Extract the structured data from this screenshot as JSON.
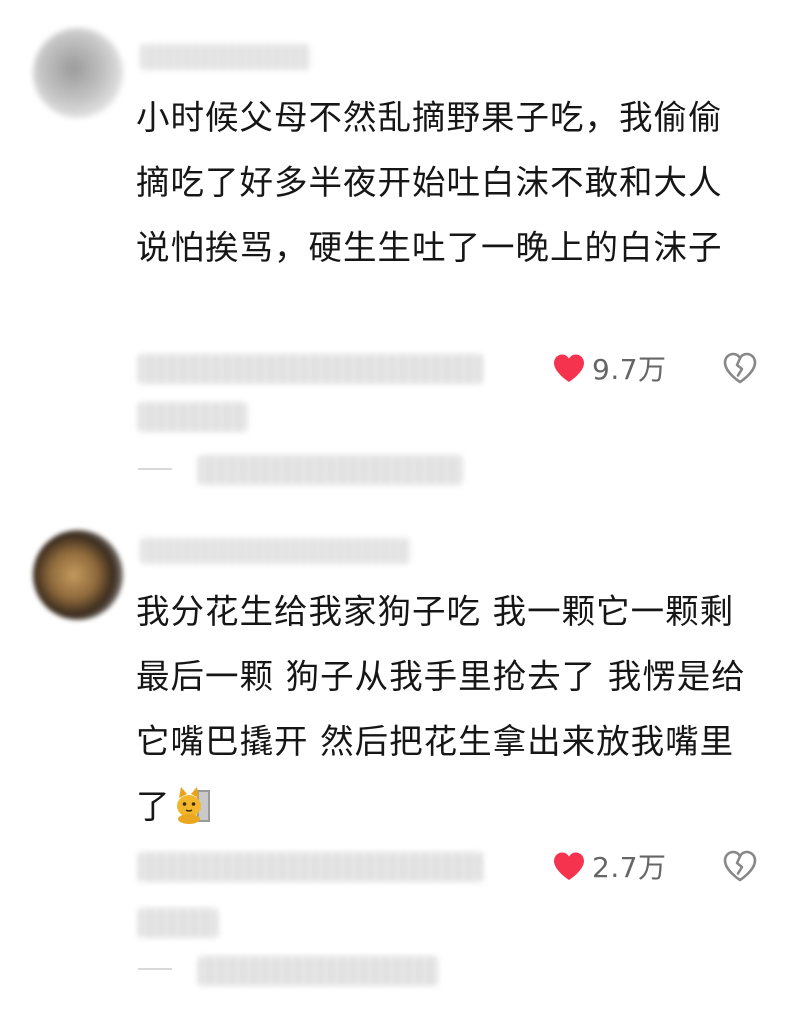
{
  "comments": [
    {
      "text": "小时候父母不然乱摘野果子吃，我偷偷摘吃了好多半夜开始吐白沫不敢和大人说怕挨骂，硬生生吐了一晚上的白沫子",
      "like_count": "9.7万",
      "avatar_icon": "blurred-avatar",
      "like_icon": "heart-icon",
      "dislike_icon": "broken-heart-icon"
    },
    {
      "text": "我分花生给我家狗子吃 我一颗它一颗剩最后一颗 狗子从我手里抢去了 我愣是给它嘴巴撬开 然后把花生拿出来放我嘴里了",
      "emoji_icon": "cat-face-icon",
      "like_count": "2.7万",
      "avatar_icon": "blurred-avatar",
      "like_icon": "heart-icon",
      "dislike_icon": "broken-heart-icon"
    }
  ],
  "colors": {
    "heart": "#f5334f",
    "text": "#161616",
    "count": "#666666",
    "icon_gray": "#888888"
  }
}
